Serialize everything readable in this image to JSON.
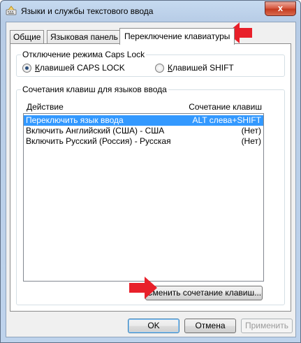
{
  "window": {
    "title": "Языки и службы текстового ввода",
    "close_glyph": "x",
    "icon": "keyboard-settings-icon"
  },
  "tabs": [
    {
      "label": "Общие",
      "active": false
    },
    {
      "label": "Языковая панель",
      "active": false
    },
    {
      "label": "Переключение клавиатуры",
      "active": true
    }
  ],
  "capslock_group": {
    "title": "Отключение режима Caps Lock",
    "options": [
      {
        "label": "Клавишей CAPS LOCK",
        "checked": true
      },
      {
        "label": "Клавишей SHIFT",
        "checked": false
      }
    ]
  },
  "hotkeys_group": {
    "title": "Сочетания клавиш для языков ввода",
    "columns": {
      "action": "Действие",
      "shortcut": "Сочетание клавиш"
    },
    "rows": [
      {
        "action": "Переключить язык ввода",
        "shortcut": "ALT слева+SHIFT",
        "selected": true
      },
      {
        "action": "Включить Английский (США) - США",
        "shortcut": "(Нет)",
        "selected": false
      },
      {
        "action": "Включить Русский (Россия) - Русская",
        "shortcut": "(Нет)",
        "selected": false
      }
    ],
    "change_button": "Сменить сочетание клавиш..."
  },
  "buttons": {
    "ok": "OK",
    "cancel": "Отмена",
    "apply": "Применить"
  },
  "colors": {
    "arrow": "#e8202a",
    "selection": "#3399ff"
  }
}
